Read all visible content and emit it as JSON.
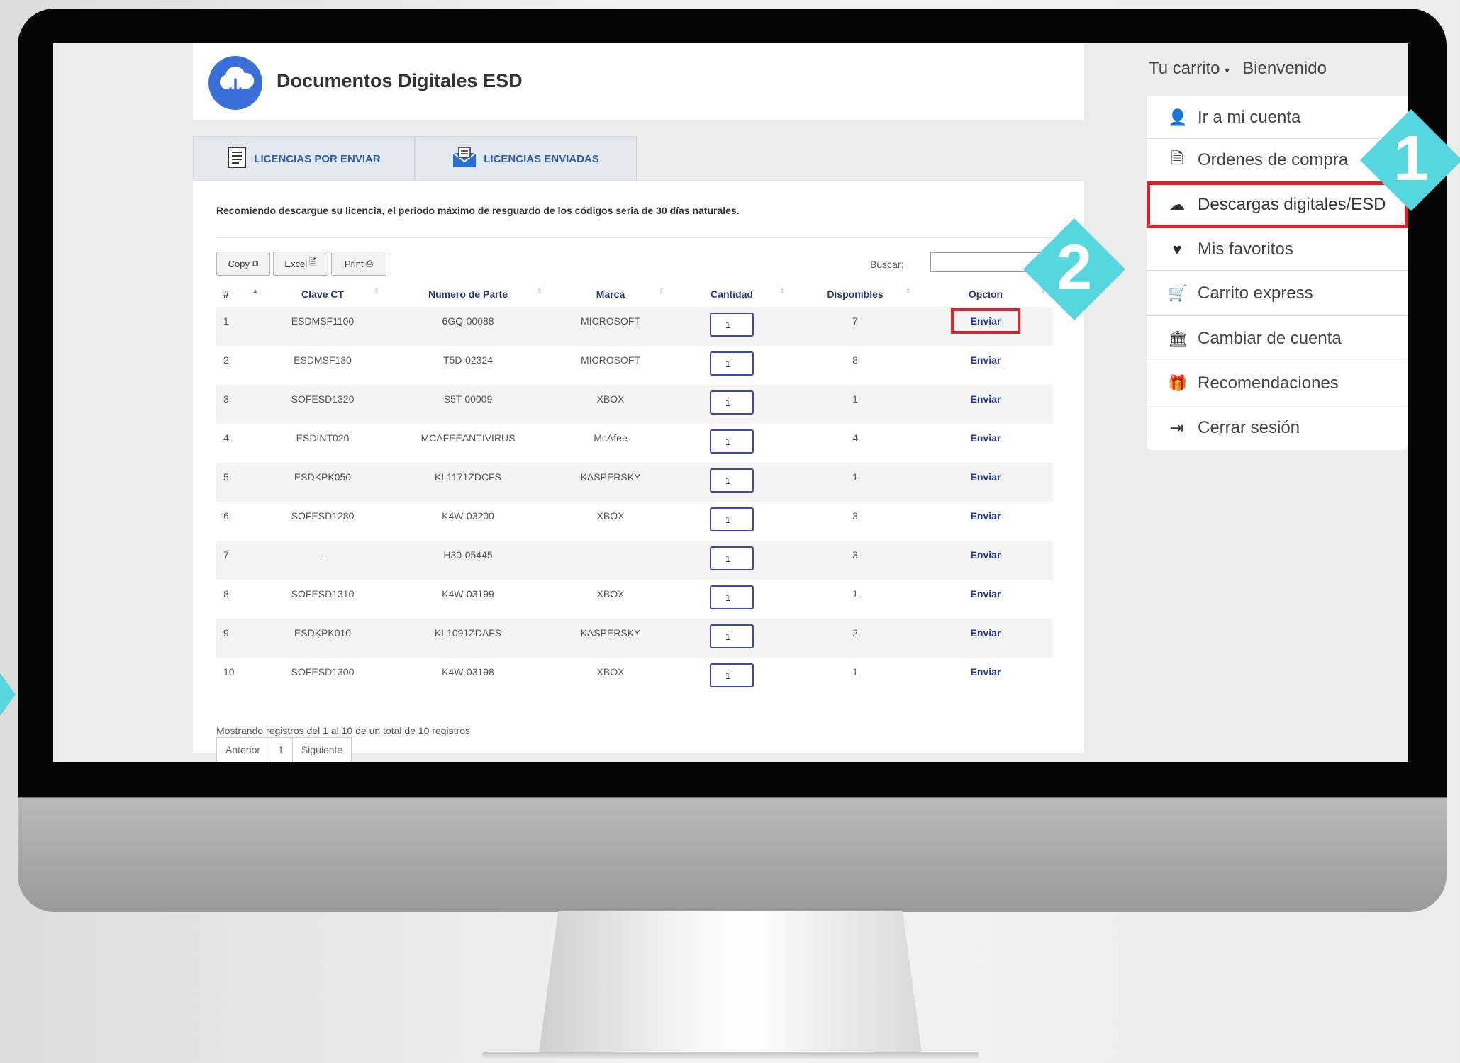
{
  "header": {
    "title": "Documentos Digitales ESD"
  },
  "tabs": [
    {
      "label": "LICENCIAS POR ENVIAR"
    },
    {
      "label": "LICENCIAS ENVIADAS"
    }
  ],
  "notice": "Recomiendo descargue su licencia, el periodo máximo de resguardo de los códigos seria de 30 días naturales.",
  "toolbar": {
    "copy": "Copy",
    "excel": "Excel",
    "print": "Print",
    "search_label": "Buscar:"
  },
  "table": {
    "headers": [
      "#",
      "Clave CT",
      "Numero de Parte",
      "Marca",
      "Cantidad",
      "Disponibles",
      "Opcion"
    ],
    "rows": [
      {
        "n": "1",
        "clave": "ESDMSF1100",
        "parte": "6GQ-00088",
        "marca": "MICROSOFT",
        "cantidad": "1",
        "disponibles": "7",
        "opcion": "Enviar"
      },
      {
        "n": "2",
        "clave": "ESDMSF130",
        "parte": "T5D-02324",
        "marca": "MICROSOFT",
        "cantidad": "1",
        "disponibles": "8",
        "opcion": "Enviar"
      },
      {
        "n": "3",
        "clave": "SOFESD1320",
        "parte": "S5T-00009",
        "marca": "XBOX",
        "cantidad": "1",
        "disponibles": "1",
        "opcion": "Enviar"
      },
      {
        "n": "4",
        "clave": "ESDINT020",
        "parte": "MCAFEEANTIVIRUS",
        "marca": "McAfee",
        "cantidad": "1",
        "disponibles": "4",
        "opcion": "Enviar"
      },
      {
        "n": "5",
        "clave": "ESDKPK050",
        "parte": "KL1171ZDCFS",
        "marca": "KASPERSKY",
        "cantidad": "1",
        "disponibles": "1",
        "opcion": "Enviar"
      },
      {
        "n": "6",
        "clave": "SOFESD1280",
        "parte": "K4W-03200",
        "marca": "XBOX",
        "cantidad": "1",
        "disponibles": "3",
        "opcion": "Enviar"
      },
      {
        "n": "7",
        "clave": "-",
        "parte": "H30-05445",
        "marca": "",
        "cantidad": "1",
        "disponibles": "3",
        "opcion": "Enviar"
      },
      {
        "n": "8",
        "clave": "SOFESD1310",
        "parte": "K4W-03199",
        "marca": "XBOX",
        "cantidad": "1",
        "disponibles": "1",
        "opcion": "Enviar"
      },
      {
        "n": "9",
        "clave": "ESDKPK010",
        "parte": "KL1091ZDAFS",
        "marca": "KASPERSKY",
        "cantidad": "1",
        "disponibles": "2",
        "opcion": "Enviar"
      },
      {
        "n": "10",
        "clave": "SOFESD1300",
        "parte": "K4W-03198",
        "marca": "XBOX",
        "cantidad": "1",
        "disponibles": "1",
        "opcion": "Enviar"
      }
    ]
  },
  "footer": {
    "info": "Mostrando registros del 1 al 10 de un total de 10 registros",
    "prev": "Anterior",
    "page": "1",
    "next": "Siguiente"
  },
  "topbar": {
    "cart": "Tu carrito",
    "welcome": "Bienvenido"
  },
  "menu": [
    {
      "label": "Ir a mi cuenta",
      "icon": "user-icon",
      "glyph": "👤"
    },
    {
      "label": "Ordenes de compra",
      "icon": "document-icon",
      "glyph": "🗎"
    },
    {
      "label": "Descargas digitales/ESD",
      "icon": "cloud-download-icon",
      "glyph": "☁"
    },
    {
      "label": "Mis favoritos",
      "icon": "heart-icon",
      "glyph": "♥"
    },
    {
      "label": "Carrito express",
      "icon": "cart-icon",
      "glyph": "🛒"
    },
    {
      "label": "Cambiar de cuenta",
      "icon": "bank-icon",
      "glyph": "🏛"
    },
    {
      "label": "Recomendaciones",
      "icon": "gift-icon",
      "glyph": "🎁"
    },
    {
      "label": "Cerrar sesión",
      "icon": "logout-icon",
      "glyph": "⇥"
    }
  ],
  "badges": [
    "1",
    "2"
  ],
  "colors": {
    "accent_blue": "#3a6fd8",
    "highlight_red": "#e0202b",
    "badge_cyan": "#56d6de",
    "link_blue": "#1f35a8"
  }
}
